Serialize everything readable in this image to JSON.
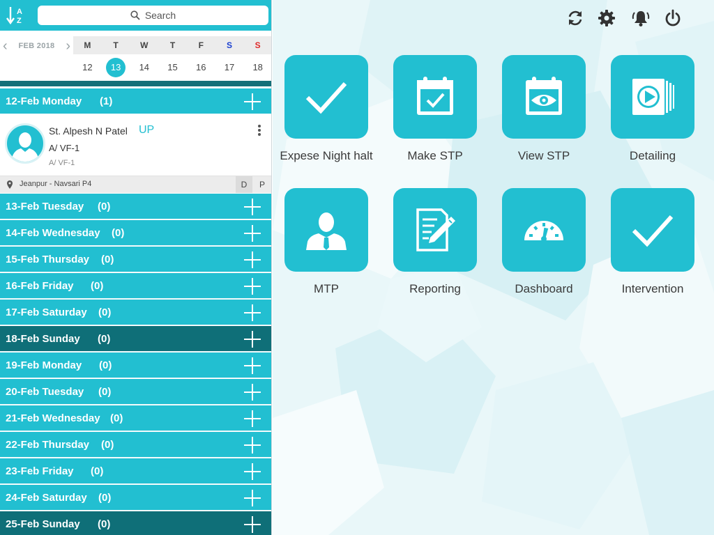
{
  "search": {
    "placeholder": "Search"
  },
  "calendar": {
    "month": "FEB 2018",
    "weekdays": [
      "M",
      "T",
      "W",
      "T",
      "F",
      "S",
      "S"
    ],
    "dates": [
      "12",
      "13",
      "14",
      "15",
      "16",
      "17",
      "18"
    ],
    "selected": "13"
  },
  "days": [
    {
      "label": "12-Feb Monday",
      "count": "(1)"
    },
    {
      "label": "13-Feb Tuesday",
      "count": "(0)"
    },
    {
      "label": "14-Feb Wednesday",
      "count": "(0)"
    },
    {
      "label": "15-Feb Thursday",
      "count": "(0)"
    },
    {
      "label": "16-Feb Friday",
      "count": "(0)"
    },
    {
      "label": "17-Feb Saturday",
      "count": "(0)"
    },
    {
      "label": "18-Feb Sunday",
      "count": "(0)"
    },
    {
      "label": "19-Feb Monday",
      "count": "(0)"
    },
    {
      "label": "20-Feb Tuesday",
      "count": "(0)"
    },
    {
      "label": "21-Feb Wednesday",
      "count": "(0)"
    },
    {
      "label": "22-Feb Thursday",
      "count": "(0)"
    },
    {
      "label": "23-Feb Friday",
      "count": "(0)"
    },
    {
      "label": "24-Feb Saturday",
      "count": "(0)"
    },
    {
      "label": "25-Feb Sunday",
      "count": "(0)"
    }
  ],
  "visit": {
    "name": "St. Alpesh N Patel",
    "tag": "UP",
    "sub1": "A/ VF-1",
    "sub2": "A/ VF-1",
    "location": "Jeanpur - Navsari P4",
    "col_d": "D",
    "col_p": "P"
  },
  "tiles": [
    {
      "label": "Expese Night halt",
      "icon": "check-icon"
    },
    {
      "label": "Make STP",
      "icon": "calendar-check-icon"
    },
    {
      "label": "View STP",
      "icon": "calendar-eye-icon"
    },
    {
      "label": "Detailing",
      "icon": "play-slides-icon"
    },
    {
      "label": "MTP",
      "icon": "person-icon"
    },
    {
      "label": "Reporting",
      "icon": "report-edit-icon"
    },
    {
      "label": "Dashboard",
      "icon": "gauge-icon"
    },
    {
      "label": "Intervention",
      "icon": "check-icon"
    }
  ],
  "header_icons": [
    "refresh-icon",
    "gear-icon",
    "bell-icon",
    "power-icon"
  ],
  "colors": {
    "accent": "#22bfd1",
    "accent_dark": "#0f6f78",
    "saturday": "#1a3fd0",
    "sunday": "#e02a2a"
  }
}
